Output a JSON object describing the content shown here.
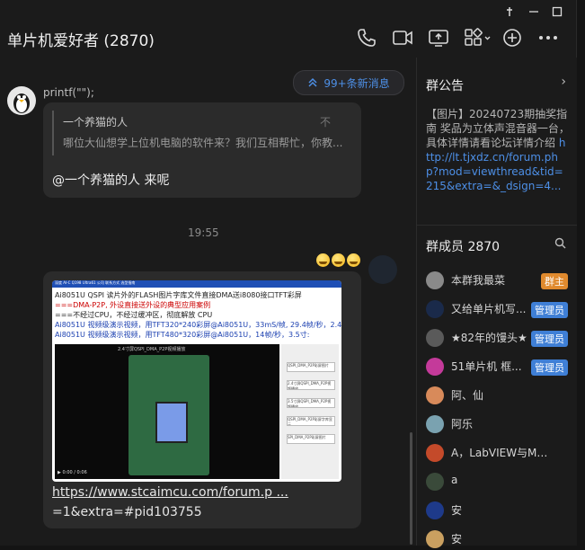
{
  "window": {
    "title": "单片机爱好者 (2870)"
  },
  "chat": {
    "new_messages_label": "99+条新消息",
    "message1": {
      "sender": "printf(\"\");",
      "quote_name": "一个养猫的人",
      "quote_text": "哪位大仙想学上位机电脑的软件来？我们互相帮忙，你教...",
      "quote_mark": "不",
      "text": "@一个养猫的人 来呢"
    },
    "timestamp": "19:55",
    "message2": {
      "image_lines": [
        "Ai8051U QSPI 读片外的FLASH图片字库文件直接DMA送i8080接口TFT彩屏",
        "===DMA-P2P, 外设直接送外设的典型应用案例",
        "===不经过CPU，不经过缓冲区，彻底解放 CPU",
        "Ai8051U 视频级演示视频，用TFT320*240彩屏@Ai8051U，33mS/帧, 29.4帧/秒，2.4寸:",
        "Ai8051U 视频级演示视频，用TFT480*320彩屏@Ai8051U，14帧/秒，3.5寸:"
      ],
      "image_nav": "深度 AI-C  Q198  Ultra61   公司   联系方式   选型指南",
      "video_caption": "2.4寸屏QSPI_DMA_P2P视频播放",
      "video_time": "0:00 / 0:06",
      "side_items": [
        "QSPI_DMA_P2P彩屏图片",
        "2.4寸屏QSPI_DMA_P2P视频播放",
        "3.5寸屏QSPI_DMA_P2P视频播放",
        "QSPI_DMA_P2P彩屏字库显示",
        "SPI_DMA_P2P彩屏图片"
      ],
      "link_line1": "https://www.stcaimcu.com/forum.p ...",
      "link_line2": "=1&extra=#pid103755"
    }
  },
  "right_panel": {
    "notice_title": "群公告",
    "notice_text": "【图片】20240723期抽奖指南 奖品为立体声混音器一台，具体详情请看论坛详情介绍 ",
    "notice_link": "http://lt.tjxdz.cn/forum.php?mod=viewthread&tid=215&extra=&_dsign=4...",
    "members_title": "群成员 2870",
    "members": [
      {
        "name": "本群我最菜",
        "badge": "群主",
        "badge_color": "#e08a2e",
        "avatar_color": "#8a8a8a"
      },
      {
        "name": "又给单片机写...",
        "badge": "管理员",
        "badge_color": "#3f7fd6",
        "avatar_color": "#1a2a4a"
      },
      {
        "name": "★82年的馒头★",
        "badge": "管理员",
        "badge_color": "#3f7fd6",
        "avatar_color": "#5a5a5a"
      },
      {
        "name": "51单片机 框...",
        "badge": "管理员",
        "badge_color": "#3f7fd6",
        "avatar_color": "#c43a9a"
      },
      {
        "name": "阿、仙",
        "badge": "",
        "badge_color": "",
        "avatar_color": "#d88a5a"
      },
      {
        "name": "阿乐",
        "badge": "",
        "badge_color": "",
        "avatar_color": "#7aa2b0"
      },
      {
        "name": "A，LabVIEW与Multi...",
        "badge": "",
        "badge_color": "",
        "avatar_color": "#c44a2a"
      },
      {
        "name": "a",
        "badge": "",
        "badge_color": "",
        "avatar_color": "#3a4a3a"
      },
      {
        "name": "安",
        "badge": "",
        "badge_color": "",
        "avatar_color": "#1e3a8a"
      },
      {
        "name": "安",
        "badge": "",
        "badge_color": "",
        "avatar_color": "#caa060"
      }
    ]
  }
}
